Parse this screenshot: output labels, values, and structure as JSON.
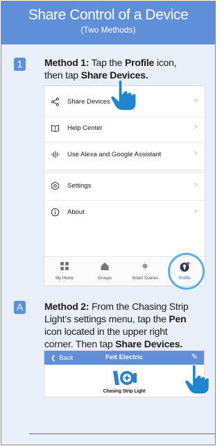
{
  "header": {
    "title": "Share Control of a Device",
    "subtitle": "(Two Methods)"
  },
  "step1": {
    "badge": "1",
    "label_method": "Method 1:",
    "text_a": " Tap the ",
    "bold_profile": "Profile",
    "text_b": " icon,",
    "text_c": "then tap ",
    "bold_share": "Share Devices."
  },
  "menu": {
    "items": [
      {
        "label": "Share Devices",
        "icon": "share-icon",
        "chevron": ">"
      },
      {
        "label": "Help Center",
        "icon": "book-icon",
        "chevron": ">"
      },
      {
        "label": "Use Alexa and Google Assistant",
        "icon": "voice-icon",
        "chevron": ">"
      },
      {
        "label": "Settings",
        "icon": "gear-icon",
        "chevron": ">"
      },
      {
        "label": "About",
        "icon": "info-icon",
        "chevron": ">"
      }
    ]
  },
  "tabbar": {
    "tabs": [
      {
        "label": "My Home",
        "icon": "grid-icon"
      },
      {
        "label": "Groups",
        "icon": "house-icon"
      },
      {
        "label": "Smart Scenes",
        "icon": "sun-icon"
      },
      {
        "label": "Profile",
        "icon": "profile-icon",
        "active": true
      }
    ]
  },
  "stepA": {
    "badge": "A",
    "label_method": "Method 2:",
    "line1_rest": " From the Chasing Strip",
    "line2_a": "Light's settings menu, tap the ",
    "bold_pen": "Pen",
    "line3": "icon located in the upper right",
    "line4_a": "corner. Then tap ",
    "bold_share": "Share Devices."
  },
  "device_screen": {
    "back_label": "Back",
    "title": "Feit Electric",
    "pen_icon": "pen-icon",
    "device_name": "Chasing Strip Light"
  },
  "colors": {
    "accent": "#5f8fd8",
    "highlight_ring": "#5aaee6",
    "hand": "#1f86cf",
    "panel": "#e9eff9"
  }
}
